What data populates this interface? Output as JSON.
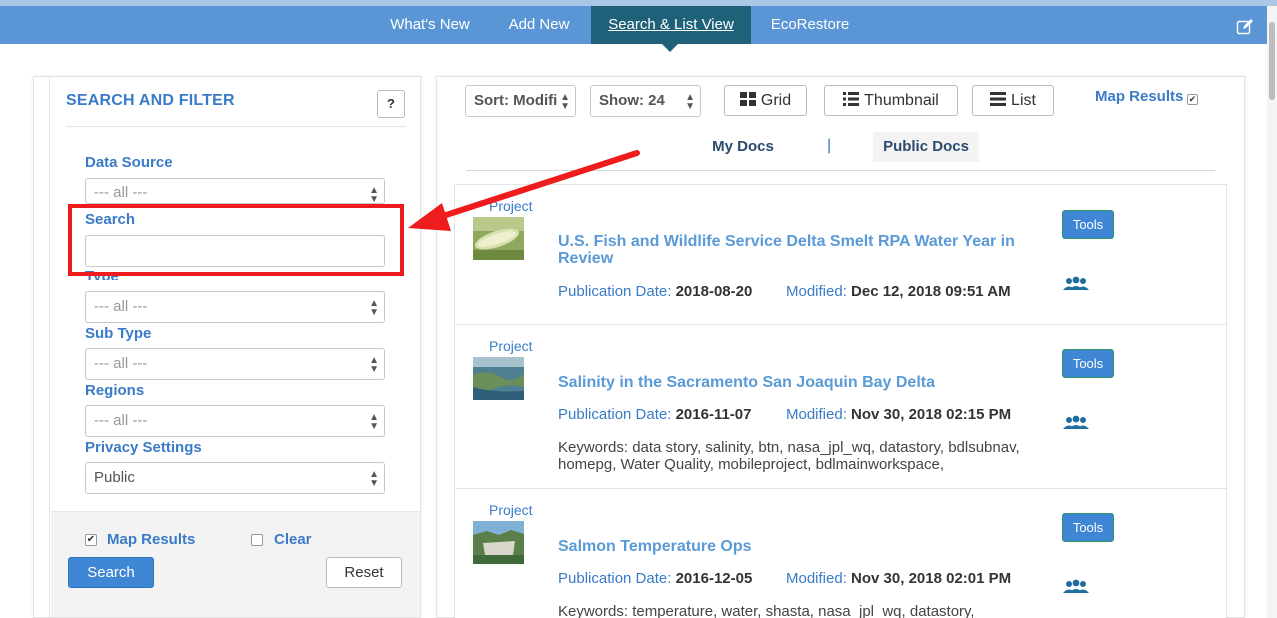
{
  "nav": {
    "items": [
      "What's New",
      "Add New",
      "Search & List View",
      "EcoRestore"
    ],
    "active_index": 2
  },
  "sidebar": {
    "title": "SEARCH AND FILTER",
    "help_label": "?",
    "data_source": {
      "label": "Data Source",
      "value": "--- all ---"
    },
    "search": {
      "label": "Search",
      "value": ""
    },
    "type": {
      "label": "Type",
      "value": "--- all ---"
    },
    "sub_type": {
      "label": "Sub Type",
      "value": "--- all ---"
    },
    "regions": {
      "label": "Regions",
      "value": "--- all ---"
    },
    "privacy": {
      "label": "Privacy Settings",
      "value": "Public"
    },
    "map_results": {
      "label": "Map Results",
      "checked": true
    },
    "clear": {
      "label": "Clear",
      "checked": false
    },
    "search_button": "Search",
    "reset_button": "Reset"
  },
  "toolbar": {
    "sort": "Sort: Modifi",
    "show": "Show: 24",
    "grid": "Grid",
    "thumbnail": "Thumbnail",
    "list": "List",
    "map_results": "Map Results",
    "map_results_checked": true
  },
  "doc_tabs": {
    "my_docs": "My Docs",
    "separator": "|",
    "public_docs": "Public Docs",
    "active": "public_docs"
  },
  "results": [
    {
      "type": "Project",
      "title": "U.S. Fish and Wildlife Service Delta Smelt RPA Water Year in Review",
      "pub_label": "Publication Date:",
      "pub_date": "2018-08-20",
      "mod_label": "Modified:",
      "modified": "Dec 12, 2018 09:51 AM",
      "keywords": "",
      "tools": "Tools"
    },
    {
      "type": "Project",
      "title": "Salinity in the Sacramento San Joaquin Bay Delta",
      "pub_label": "Publication Date:",
      "pub_date": "2016-11-07",
      "mod_label": "Modified:",
      "modified": "Nov 30, 2018 02:15 PM",
      "keywords": "Keywords: data story, salinity, btn, nasa_jpl_wq, datastory, bdlsubnav, homepg, Water Quality, mobileproject, bdlmainworkspace,",
      "tools": "Tools"
    },
    {
      "type": "Project",
      "title": "Salmon Temperature Ops",
      "pub_label": "Publication Date:",
      "pub_date": "2016-12-05",
      "mod_label": "Modified:",
      "modified": "Nov 30, 2018 02:01 PM",
      "keywords": "Keywords: temperature, water, shasta, nasa_jpl_wq, datastory,",
      "tools": "Tools"
    }
  ],
  "colors": {
    "nav_bg": "#5a96d6",
    "nav_active": "#1f6178",
    "accent": "#3a7bc8",
    "highlight": "#ee1c1c"
  }
}
